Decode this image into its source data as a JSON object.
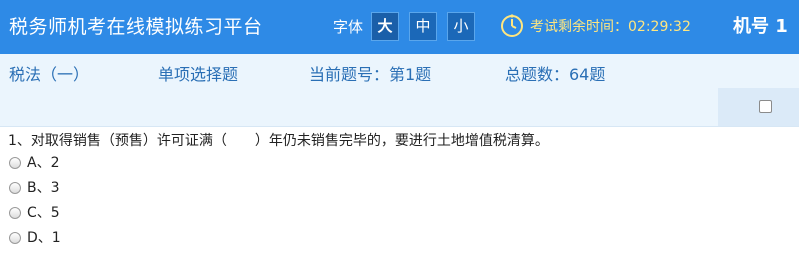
{
  "header": {
    "title": "税务师机考在线模拟练习平台",
    "font_label": "字体",
    "font_sizes": [
      "大",
      "中",
      "小"
    ],
    "selected_font_size": "大",
    "timer": "考试剩余时间：02:29:32",
    "machine_label": "机号 1",
    "timer_color": "#ffe680",
    "bar_color": "#2e8ae6"
  },
  "info": {
    "subject": "税法（一）",
    "question_type": "单项选择题",
    "current_question": "当前题号：第1题",
    "total_questions": "总题数：64题"
  },
  "question": {
    "text": "1、对取得销售（预售）许可证满（　　）年仍未销售完毕的，要进行土地增值税清算。",
    "options": [
      "A、2",
      "B、3",
      "C、5",
      "D、1"
    ]
  },
  "icons": {
    "timer": "clock-icon",
    "mark": "checkbox"
  }
}
